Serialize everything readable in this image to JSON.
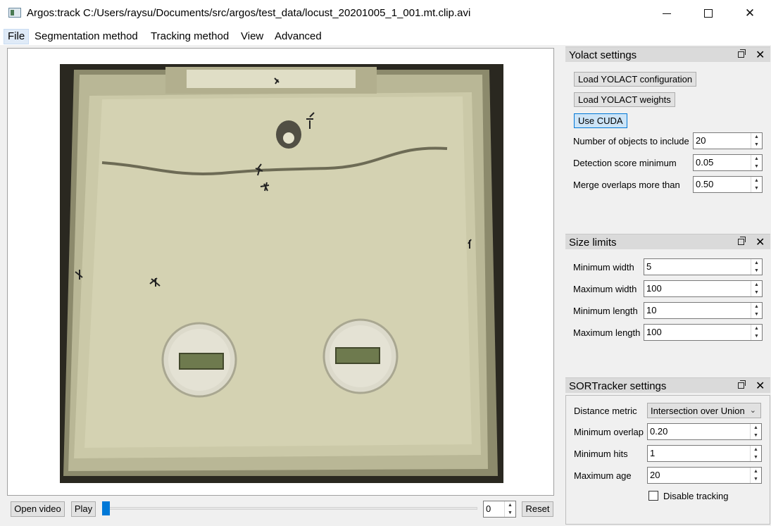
{
  "window": {
    "title": "Argos:track C:/Users/raysu/Documents/src/argos/test_data/locust_20201005_1_001.mt.clip.avi"
  },
  "menu": [
    "File",
    "Segmentation method",
    "Tracking method",
    "View",
    "Advanced"
  ],
  "controls": {
    "open_video": "Open video",
    "play": "Play",
    "frame_value": "0",
    "reset": "Reset",
    "slider_position": 0
  },
  "yolact": {
    "title": "Yolact settings",
    "load_config": "Load YOLACT configuration",
    "load_weights": "Load YOLACT weights",
    "use_cuda": "Use CUDA",
    "fields": [
      {
        "label": "Number of objects to include",
        "value": "20"
      },
      {
        "label": "Detection score minimum",
        "value": "0.05"
      },
      {
        "label": "Merge overlaps more than",
        "value": "0.50"
      }
    ]
  },
  "size_limits": {
    "title": "Size limits",
    "fields": [
      {
        "label": "Minimum width",
        "value": "5"
      },
      {
        "label": "Maximum width",
        "value": "100"
      },
      {
        "label": "Minimum length",
        "value": "10"
      },
      {
        "label": "Maximum length",
        "value": "100"
      }
    ]
  },
  "sortracker": {
    "title": "SORTracker settings",
    "distance_metric_label": "Distance metric",
    "distance_metric_value": "Intersection over Union",
    "fields": [
      {
        "label": "Minimum overlap",
        "value": "0.20"
      },
      {
        "label": "Minimum hits",
        "value": "1"
      },
      {
        "label": "Maximum age",
        "value": "20"
      }
    ],
    "disable_tracking": "Disable tracking"
  },
  "icons": {
    "app": "app-icon",
    "float": "float-panel-icon",
    "close": "close-icon",
    "spin_up": "arrow-up-icon",
    "spin_down": "arrow-down-icon",
    "dropdown": "chevron-down-icon"
  }
}
